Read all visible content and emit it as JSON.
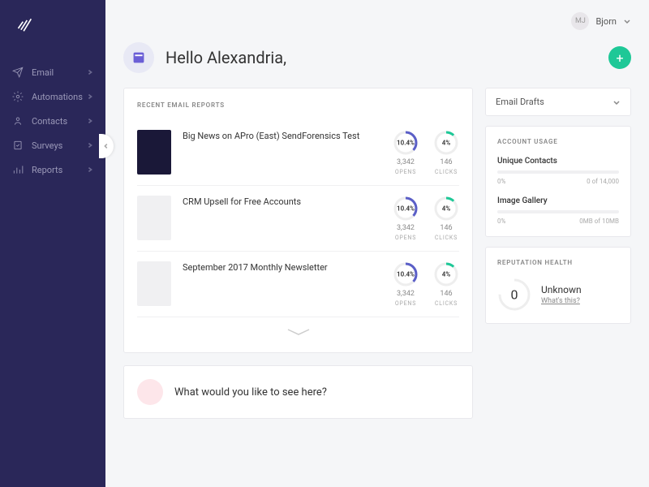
{
  "header": {
    "avatar_initials": "MJ",
    "username": "Bjorn"
  },
  "greeting": "Hello Alexandria,",
  "sidebar": {
    "items": [
      {
        "label": "Email"
      },
      {
        "label": "Automations"
      },
      {
        "label": "Contacts"
      },
      {
        "label": "Surveys"
      },
      {
        "label": "Reports"
      }
    ]
  },
  "reports_title": "RECENT EMAIL REPORTS",
  "reports": [
    {
      "title": "Big News on APro (East) SendForensics Test",
      "opens_pct": "10.4%",
      "clicks_pct": "4%",
      "opens": "3,342",
      "clicks": "146"
    },
    {
      "title": "CRM Upsell for Free Accounts",
      "opens_pct": "10.4%",
      "clicks_pct": "4%",
      "opens": "3,342",
      "clicks": "146"
    },
    {
      "title": "September 2017 Monthly Newsletter",
      "opens_pct": "10.4%",
      "clicks_pct": "4%",
      "opens": "3,342",
      "clicks": "146"
    }
  ],
  "opens_label": "OPENS",
  "clicks_label": "CLICKS",
  "dropdown": "Email Drafts",
  "usage": {
    "title": "ACCOUNT USAGE",
    "items": [
      {
        "label": "Unique Contacts",
        "pct": "0%",
        "meta": "0 of 14,000"
      },
      {
        "label": "Image Gallery",
        "pct": "0%",
        "meta": "0MB of 10MB"
      }
    ]
  },
  "reputation": {
    "title": "REPUTATION HEALTH",
    "score": "0",
    "status": "Unknown",
    "link": "What's this?"
  },
  "bottom_prompt": "What would you like to see here?"
}
